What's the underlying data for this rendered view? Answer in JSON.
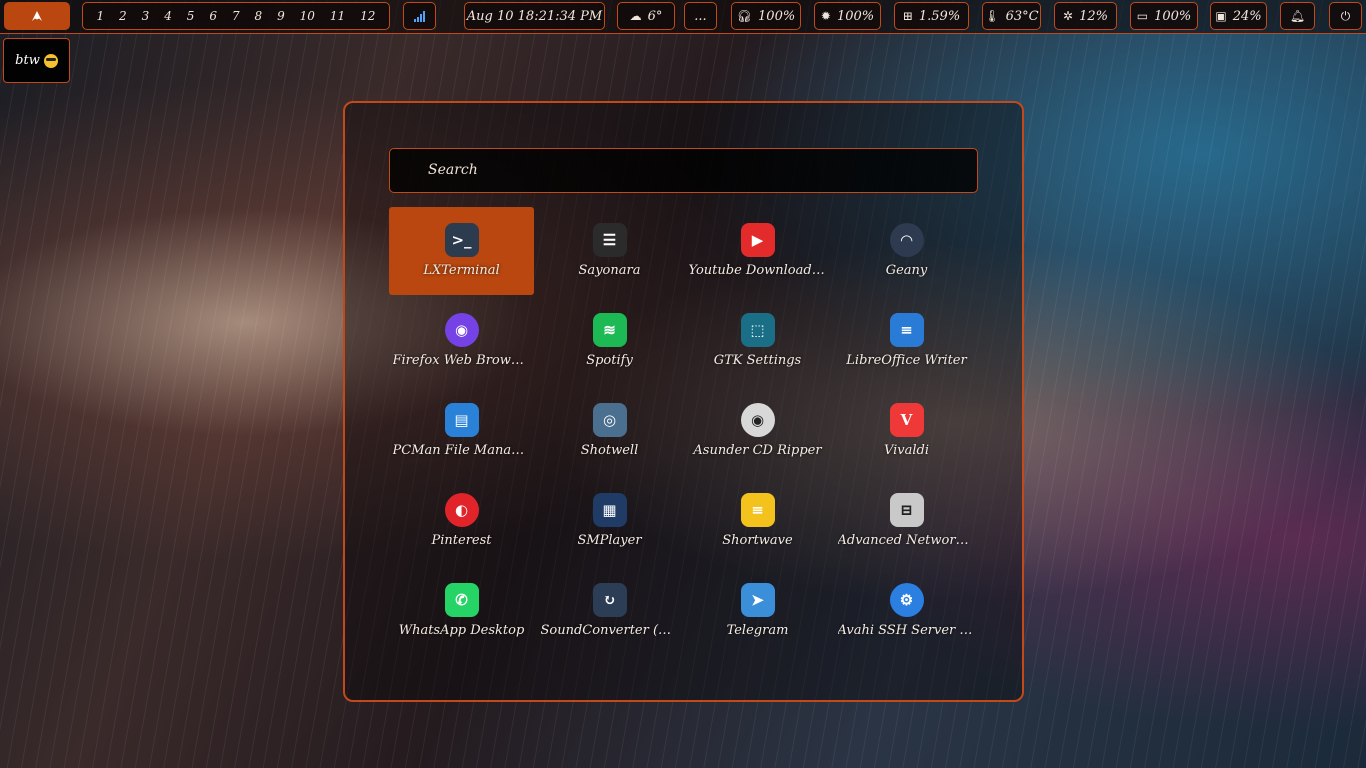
{
  "topbar": {
    "workspaces": [
      "1",
      "2",
      "3",
      "4",
      "5",
      "6",
      "7",
      "8",
      "9",
      "10",
      "11",
      "12"
    ],
    "clock": "Aug 10 18:21:34 PM",
    "weather": "6°",
    "more": "...",
    "headphones_volume": "100%",
    "brightness": "100%",
    "cpu": "1.59%",
    "temperature": "63°C",
    "memory": "12%",
    "battery": "100%",
    "disk": "24%"
  },
  "desktop": {
    "btw_label": "btw"
  },
  "menu": {
    "search_placeholder": "Search",
    "apps": [
      {
        "label": "LXTerminal",
        "icon": "terminal-icon",
        "selected": true
      },
      {
        "label": "Sayonara",
        "icon": "list-icon"
      },
      {
        "label": "Youtube Downloade...",
        "icon": "youtube-icon"
      },
      {
        "label": "Geany",
        "icon": "geany-icon"
      },
      {
        "label": "Firefox Web Browser",
        "icon": "firefox-icon"
      },
      {
        "label": "Spotify",
        "icon": "spotify-icon"
      },
      {
        "label": "GTK Settings",
        "icon": "gtk-settings-icon"
      },
      {
        "label": "LibreOffice Writer",
        "icon": "writer-icon"
      },
      {
        "label": "PCMan File Manager",
        "icon": "file-manager-icon"
      },
      {
        "label": "Shotwell",
        "icon": "camera-icon"
      },
      {
        "label": "Asunder CD Ripper",
        "icon": "cd-icon"
      },
      {
        "label": "Vivaldi",
        "icon": "vivaldi-icon"
      },
      {
        "label": "Pinterest",
        "icon": "pinterest-icon"
      },
      {
        "label": "SMPlayer",
        "icon": "smplayer-icon"
      },
      {
        "label": "Shortwave",
        "icon": "radio-icon"
      },
      {
        "label": "Advanced Network ...",
        "icon": "network-icon"
      },
      {
        "label": "WhatsApp Desktop",
        "icon": "whatsapp-icon"
      },
      {
        "label": "SoundConverter (dark)",
        "icon": "soundconverter-icon"
      },
      {
        "label": "Telegram",
        "icon": "telegram-icon"
      },
      {
        "label": "Avahi SSH Server B...",
        "icon": "avahi-icon"
      }
    ]
  },
  "colors": {
    "accent": "#c2491a",
    "selected": "#b9470f"
  }
}
